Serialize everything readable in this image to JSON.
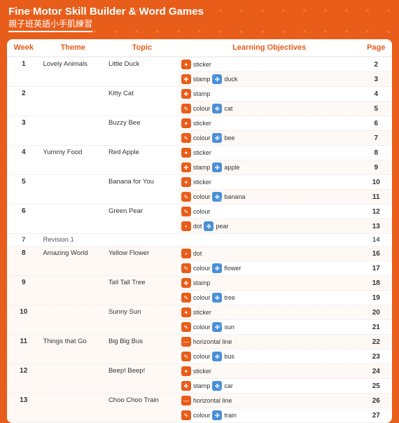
{
  "header": {
    "title": "Fine Motor Skill Builder & Word Games",
    "subtitle": "親子班英語小手肌練習"
  },
  "columns": {
    "week": "Week",
    "theme": "Theme",
    "topic": "Topic",
    "objectives": "Learning Objectives",
    "page": "Page"
  },
  "rows": [
    {
      "week": "1",
      "theme": "Lovely Animals",
      "topic": "Little Duck",
      "objectives": [
        [
          "sticker",
          ""
        ],
        [
          "stamp",
          "duck"
        ]
      ],
      "pages": [
        "2",
        "3"
      ]
    },
    {
      "week": "2",
      "theme": "",
      "topic": "Kitty Cat",
      "objectives": [
        [
          "stamp",
          ""
        ],
        [
          "colour",
          "cat"
        ]
      ],
      "pages": [
        "4",
        "5"
      ]
    },
    {
      "week": "3",
      "theme": "",
      "topic": "Buzzy Bee",
      "objectives": [
        [
          "sticker",
          ""
        ],
        [
          "colour",
          "bee"
        ]
      ],
      "pages": [
        "6",
        "7"
      ]
    },
    {
      "week": "4",
      "theme": "Yummy Food",
      "topic": "Red Apple",
      "objectives": [
        [
          "sticker",
          ""
        ],
        [
          "stamp",
          "apple"
        ]
      ],
      "pages": [
        "8",
        "9"
      ]
    },
    {
      "week": "5",
      "theme": "",
      "topic": "Banana for You",
      "objectives": [
        [
          "sticker",
          ""
        ],
        [
          "colour",
          "banana"
        ]
      ],
      "pages": [
        "10",
        "11"
      ]
    },
    {
      "week": "6",
      "theme": "",
      "topic": "Green Pear",
      "objectives": [
        [
          "colour",
          ""
        ],
        [
          "dot",
          "pear"
        ]
      ],
      "pages": [
        "12",
        "13"
      ]
    },
    {
      "week": "7",
      "theme": "Revision 1",
      "topic": "",
      "objectives": [],
      "pages": [
        "14",
        ""
      ]
    },
    {
      "week": "8",
      "theme": "Amazing World",
      "topic": "Yellow Flower",
      "objectives": [
        [
          "dot",
          ""
        ],
        [
          "colour",
          "flower"
        ]
      ],
      "pages": [
        "16",
        "17"
      ]
    },
    {
      "week": "9",
      "theme": "",
      "topic": "Tall Tall Tree",
      "objectives": [
        [
          "stamp",
          ""
        ],
        [
          "colour",
          "tree"
        ]
      ],
      "pages": [
        "18",
        "19"
      ]
    },
    {
      "week": "10",
      "theme": "",
      "topic": "Sunny Sun",
      "objectives": [
        [
          "sticker",
          ""
        ],
        [
          "colour",
          "sun"
        ]
      ],
      "pages": [
        "20",
        "21"
      ]
    },
    {
      "week": "11",
      "theme": "Things that Go",
      "topic": "Big Big Bus",
      "objectives": [
        [
          "horizontal line",
          ""
        ],
        [
          "colour",
          "bus"
        ]
      ],
      "pages": [
        "22",
        "23"
      ]
    },
    {
      "week": "12",
      "theme": "",
      "topic": "Beep! Beep!",
      "objectives": [
        [
          "sticker",
          ""
        ],
        [
          "stamp",
          "car"
        ]
      ],
      "pages": [
        "24",
        "25"
      ]
    },
    {
      "week": "13",
      "theme": "",
      "topic": "Choo Choo Train",
      "objectives": [
        [
          "horizontal line",
          ""
        ],
        [
          "colour",
          "train"
        ]
      ],
      "pages": [
        "26",
        "27"
      ]
    }
  ]
}
